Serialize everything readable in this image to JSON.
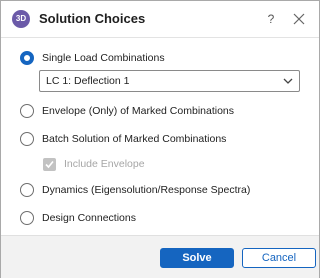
{
  "dialog": {
    "icon_text": "3D",
    "title": "Solution Choices",
    "help_label": "?",
    "close_icon": "close-icon"
  },
  "options": {
    "single": "Single Load Combinations",
    "envelope": "Envelope (Only) of Marked Combinations",
    "batch": "Batch Solution of Marked Combinations",
    "dynamics": "Dynamics (Eigensolution/Response Spectra)",
    "design": "Design Connections",
    "selected": "single"
  },
  "combination_select": {
    "value": "LC 1: Deflection 1"
  },
  "include_envelope": {
    "label": "Include Envelope",
    "checked": true,
    "disabled": true
  },
  "footer": {
    "solve_label": "Solve",
    "cancel_label": "Cancel"
  },
  "colors": {
    "accent": "#1565c0",
    "disabled": "#a6a6a6"
  }
}
